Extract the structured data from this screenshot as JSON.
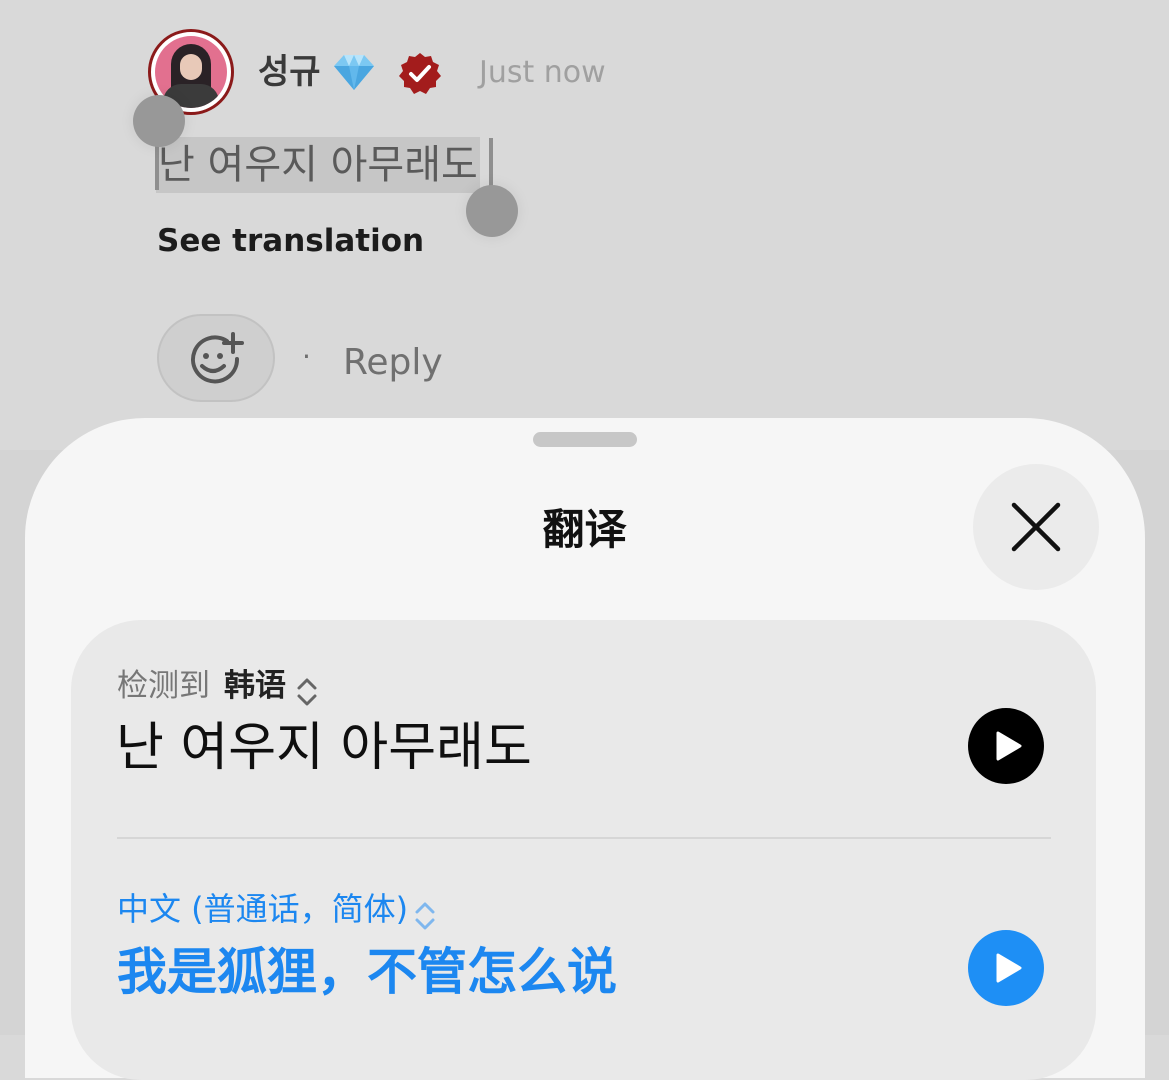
{
  "comment": {
    "username": "성규",
    "emoji_name": "gem-diamond",
    "verified_color": "#a31c1c",
    "timestamp": "Just now",
    "text": "난 여우지 아무래도",
    "see_translation_label": "See translation",
    "separator": "·",
    "reply_label": "Reply"
  },
  "sheet": {
    "title": "翻译",
    "source": {
      "detected_label": "检测到",
      "language": "韩语",
      "text": "난 여우지 아무래도"
    },
    "target": {
      "language": "中文 (普通话，简体)",
      "text": "我是狐狸，不管怎么说"
    }
  },
  "colors": {
    "accent_blue": "#1c87f0",
    "sheet_bg": "#f6f6f6",
    "card_bg": "#e9e9e9"
  }
}
